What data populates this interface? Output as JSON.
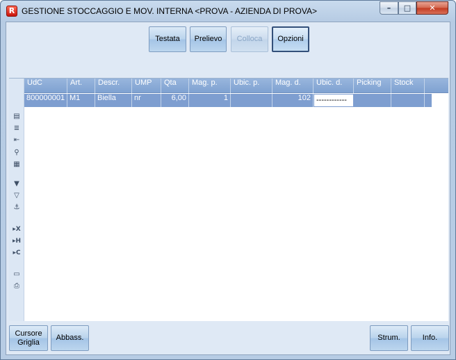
{
  "window": {
    "title": "GESTIONE STOCCAGGIO E MOV. INTERNA <PROVA - AZIENDA DI PROVA>",
    "app_icon_glyph": "R",
    "controls": {
      "minimize": "–",
      "maximize": "□",
      "close": "✕"
    }
  },
  "toolbar": {
    "testata": "Testata",
    "prelievo": "Prelievo",
    "colloca": "Colloca",
    "opzioni": "Opzioni"
  },
  "grid": {
    "columns": [
      "UdC",
      "Art.",
      "Descr.",
      "UMP",
      "Qta",
      "Mag. p.",
      "Ubic. p.",
      "Mag. d.",
      "Ubic. d.",
      "Picking",
      "Stock"
    ],
    "rows": [
      {
        "udc": "800000001",
        "art": "M1",
        "descr": "Biella",
        "ump": "nr",
        "qta": "6,00",
        "mag_p": "1",
        "ubic_p": "",
        "mag_d": "102",
        "ubic_d": "------------",
        "picking": "",
        "stock": ""
      }
    ],
    "side_tools": [
      "grid-config-icon",
      "list-icon",
      "export-icon",
      "search-icon",
      "columns-icon",
      "filter-icon",
      "clear-filter-icon",
      "anchor-icon",
      "hide-x-icon",
      "hide-h-icon",
      "hide-c-icon",
      "monitor-icon",
      "print-icon"
    ]
  },
  "footer": {
    "cursore_griglia": "Cursore Griglia",
    "abbass": "Abbass.",
    "strum": "Strum.",
    "info": "Info."
  },
  "colors": {
    "header_bg": "#8aacd8",
    "selected_row": "#7e9ed0",
    "client_bg": "#dfe9f5",
    "title_bar": "#c9dbee"
  }
}
